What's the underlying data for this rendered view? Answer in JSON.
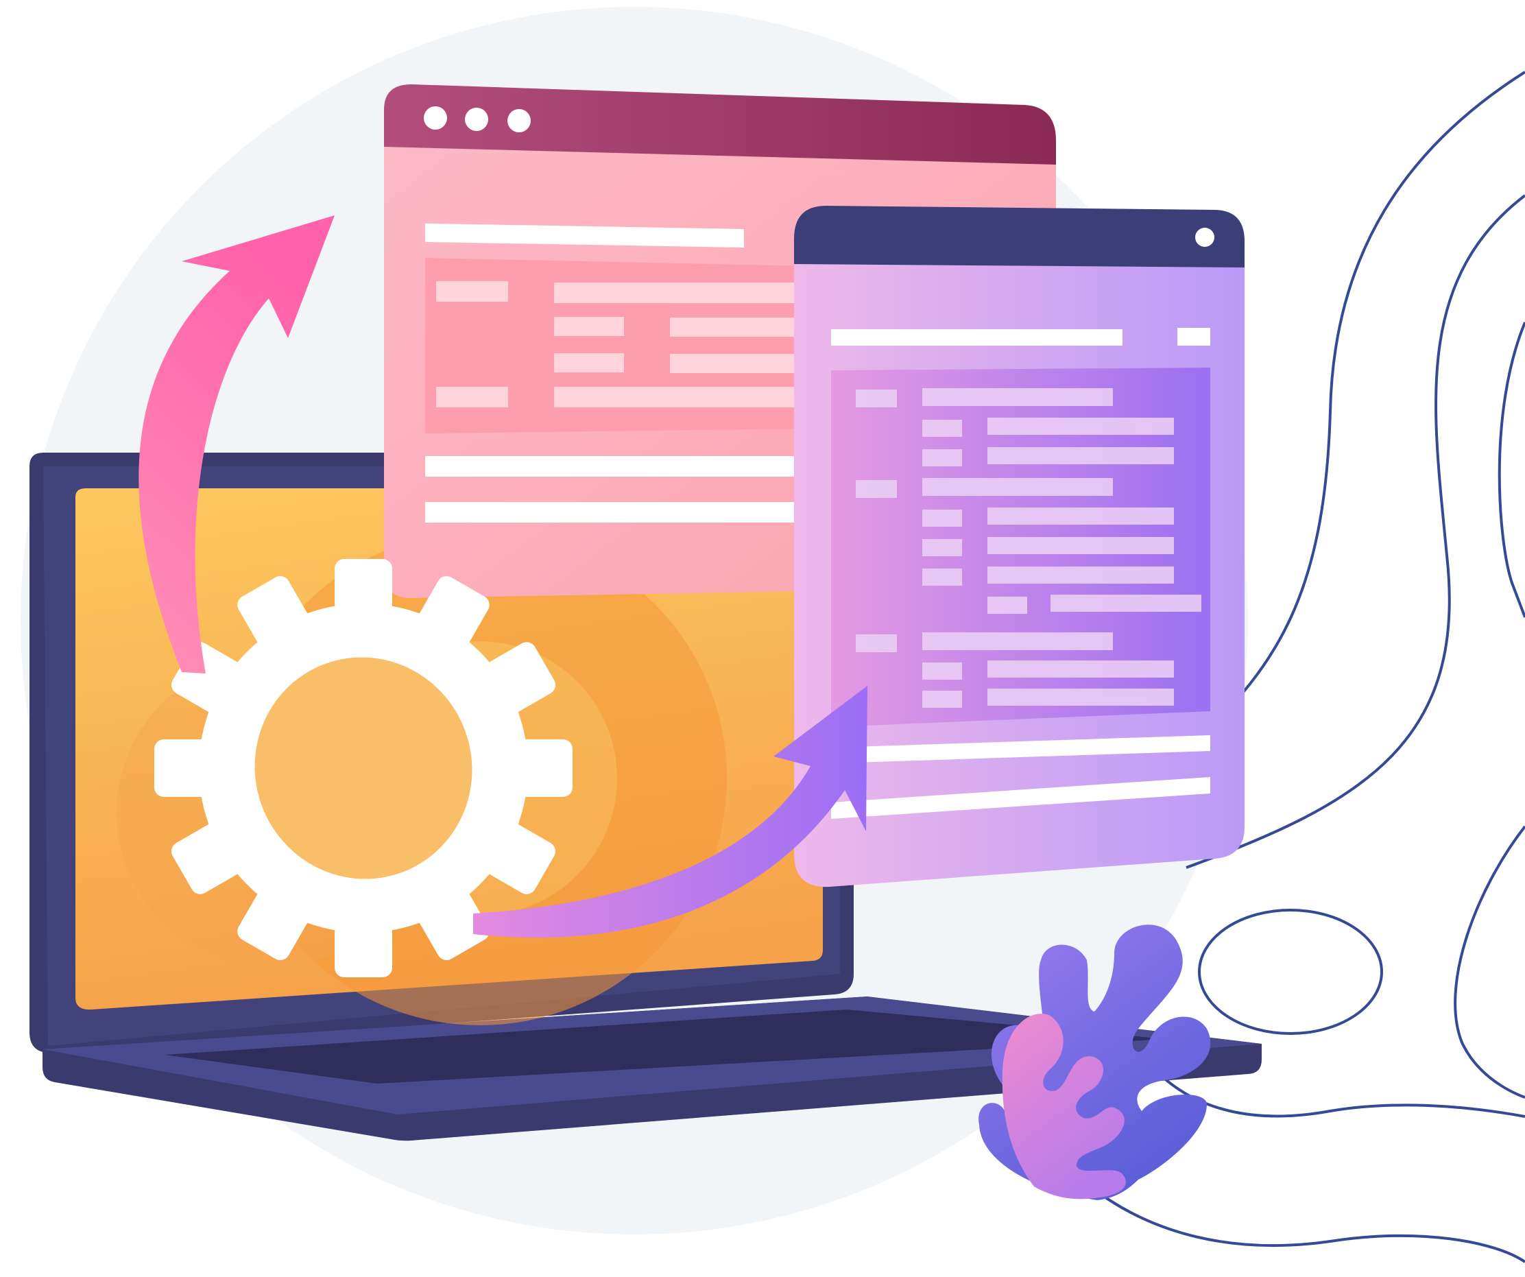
{
  "illustration": {
    "subject": "laptop-with-gear-and-transfer-arrows-between-browser-windows",
    "palette": {
      "background_circle": "#F1F5F8",
      "laptop_dark": "#3B3A6E",
      "laptop_mid": "#4B4A87",
      "laptop_screen_top": "#FBC766",
      "laptop_screen_bottom": "#F6A24A",
      "gear_white": "#FFFFFF",
      "pink_window_body": "#FCB0BE",
      "pink_window_bar": "#8B2A55",
      "purple_window_body": "#D9A6EA",
      "purple_window_bar": "#3C3E78",
      "arrow_pink": "#FF6EAD",
      "arrow_purple": "#9C6EF5",
      "line_blue": "#354A96",
      "leaf_blue": "#6E69E2",
      "leaf_pink": "#D68AD8"
    },
    "icons": {
      "gear": "gear-icon",
      "up_arrow": "curved-arrow-up-icon",
      "right_arrow": "curved-arrow-right-icon",
      "window_controls": "window-dots-icon"
    }
  }
}
